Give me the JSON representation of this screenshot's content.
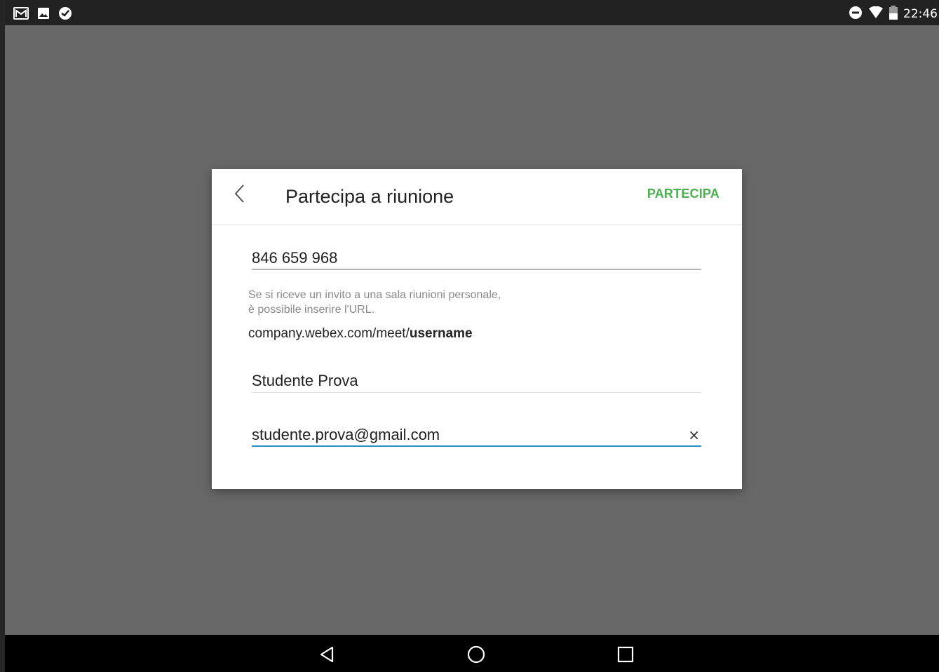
{
  "status_bar": {
    "time": "22:46",
    "left_icons": [
      "gmail-icon",
      "gallery-icon",
      "check-circle-icon"
    ],
    "right_icons": [
      "do-not-disturb-icon",
      "wifi-icon",
      "battery-icon"
    ]
  },
  "dialog": {
    "title": "Partecipa a riunione",
    "join_label": "PARTECIPA",
    "meeting_number": "846 659 968",
    "hint_line1": "Se si riceve un invito a una sala riunioni personale,",
    "hint_line2": "è possibile inserire l'URL.",
    "url_prefix": "company.webex.com/meet/",
    "url_user": "username",
    "name_value": "Studente Prova",
    "email_value": "studente.prova@gmail.com",
    "clear_glyph": "×"
  },
  "colors": {
    "accent": "#4caf50",
    "focus_underline": "#2c8fc9",
    "overlay": "#686868"
  },
  "nav_bar": {
    "buttons": [
      "back-icon",
      "home-icon",
      "recents-icon"
    ]
  }
}
